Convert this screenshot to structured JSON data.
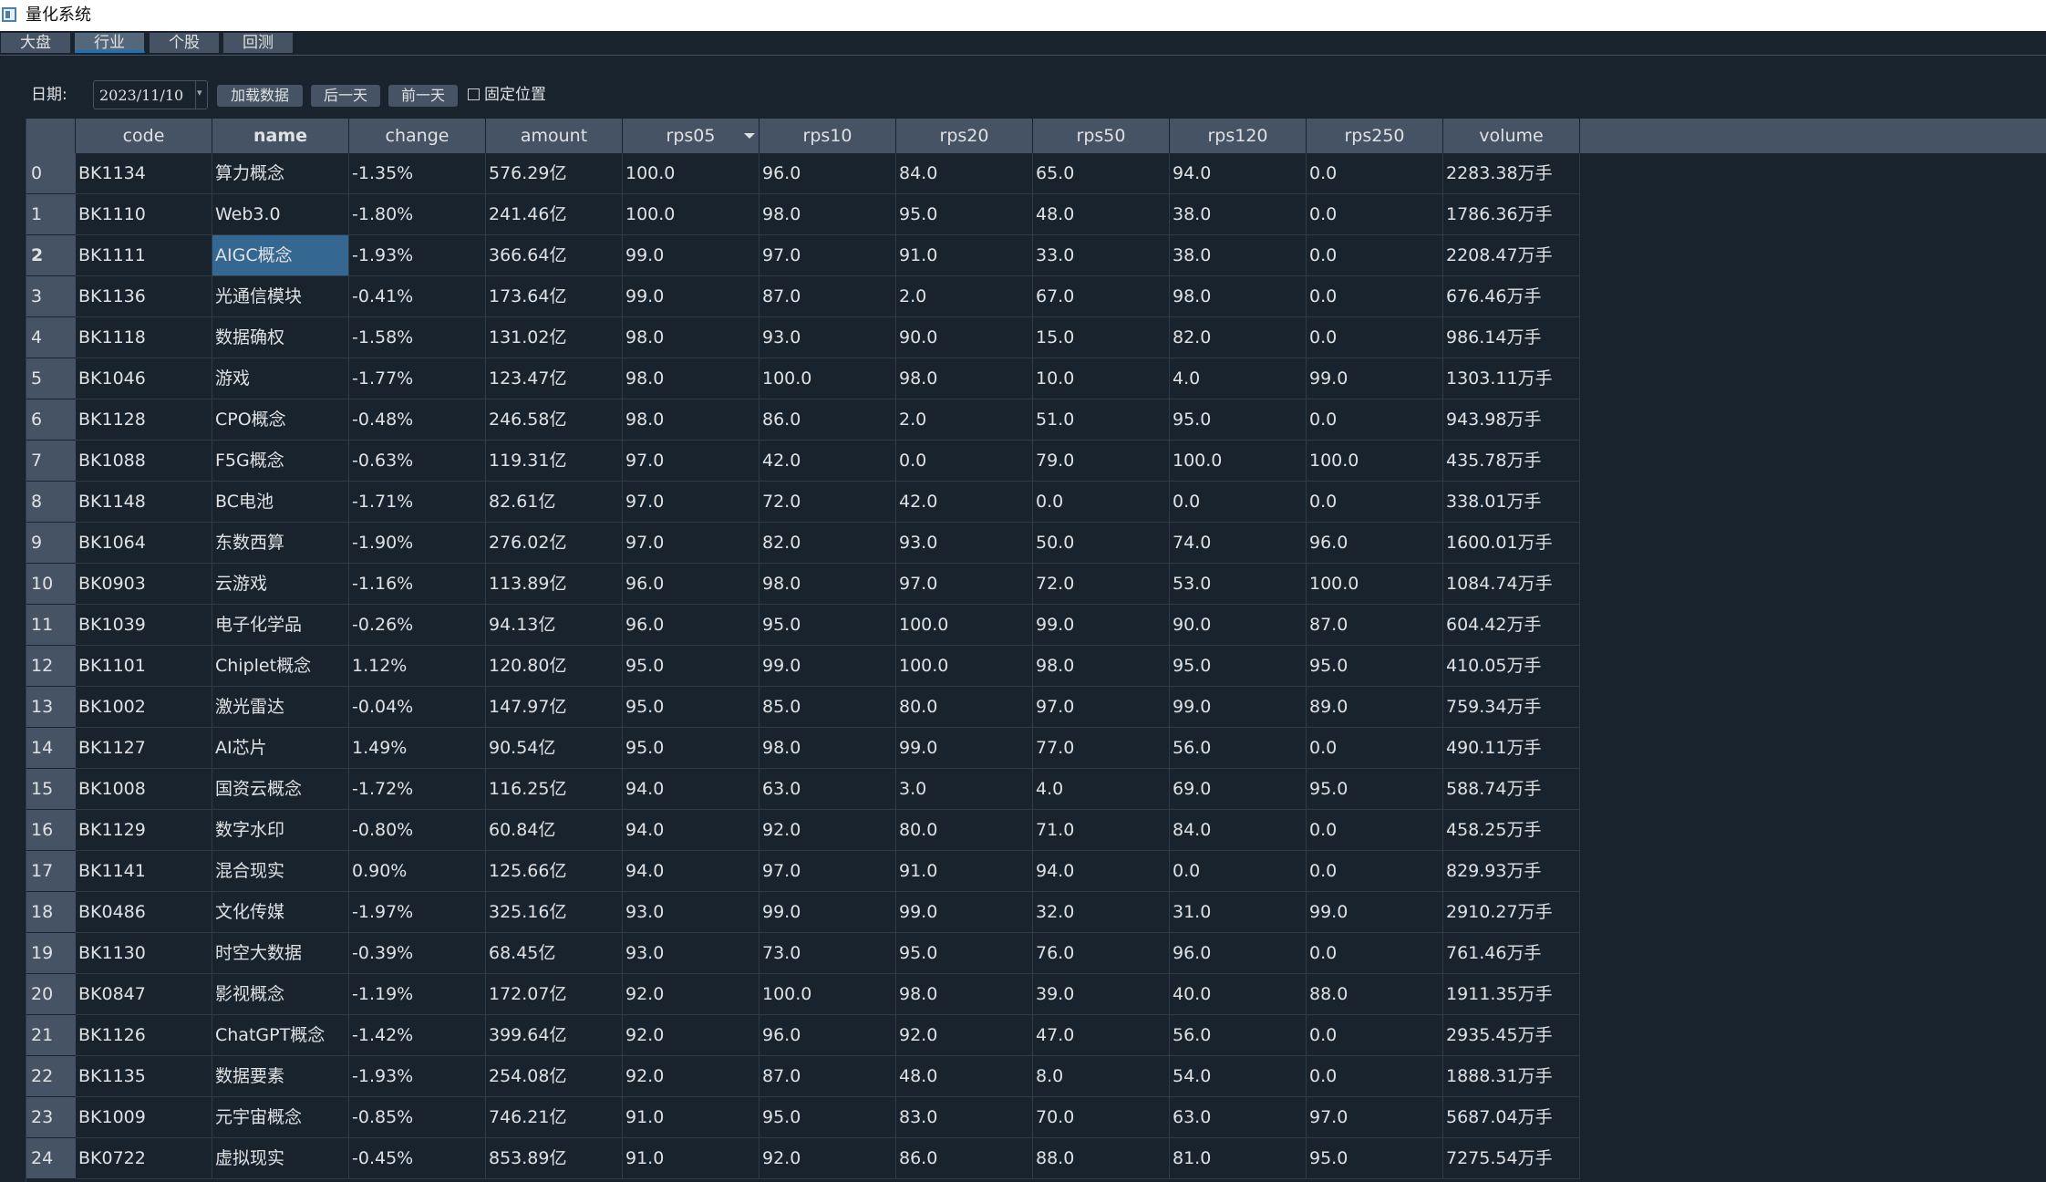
{
  "window": {
    "title": "量化系统",
    "icon": "app-window-icon"
  },
  "tabs": [
    {
      "label": "大盘"
    },
    {
      "label": "行业",
      "active": true
    },
    {
      "label": "个股"
    },
    {
      "label": "回测"
    }
  ],
  "toolbar": {
    "date_label": "日期:",
    "date_value": "2023/11/10",
    "load_button": "加载数据",
    "next_day_button": "后一天",
    "prev_day_button": "前一天",
    "fixed_position_label": "固定位置",
    "fixed_position_checked": false
  },
  "table": {
    "columns": [
      "code",
      "name",
      "change",
      "amount",
      "rps05",
      "rps10",
      "rps20",
      "rps50",
      "rps120",
      "rps250",
      "volume"
    ],
    "sorted_column": "rps05",
    "current_row": 2,
    "selected_cell": {
      "row": 2,
      "column": "name"
    },
    "rows": [
      [
        "0",
        "BK1134",
        "算力概念",
        "-1.35%",
        "576.29亿",
        "100.0",
        "96.0",
        "84.0",
        "65.0",
        "94.0",
        "0.0",
        "2283.38万手"
      ],
      [
        "1",
        "BK1110",
        "Web3.0",
        "-1.80%",
        "241.46亿",
        "100.0",
        "98.0",
        "95.0",
        "48.0",
        "38.0",
        "0.0",
        "1786.36万手"
      ],
      [
        "2",
        "BK1111",
        "AIGC概念",
        "-1.93%",
        "366.64亿",
        "99.0",
        "97.0",
        "91.0",
        "33.0",
        "38.0",
        "0.0",
        "2208.47万手"
      ],
      [
        "3",
        "BK1136",
        "光通信模块",
        "-0.41%",
        "173.64亿",
        "99.0",
        "87.0",
        "2.0",
        "67.0",
        "98.0",
        "0.0",
        "676.46万手"
      ],
      [
        "4",
        "BK1118",
        "数据确权",
        "-1.58%",
        "131.02亿",
        "98.0",
        "93.0",
        "90.0",
        "15.0",
        "82.0",
        "0.0",
        "986.14万手"
      ],
      [
        "5",
        "BK1046",
        "游戏",
        "-1.77%",
        "123.47亿",
        "98.0",
        "100.0",
        "98.0",
        "10.0",
        "4.0",
        "99.0",
        "1303.11万手"
      ],
      [
        "6",
        "BK1128",
        "CPO概念",
        "-0.48%",
        "246.58亿",
        "98.0",
        "86.0",
        "2.0",
        "51.0",
        "95.0",
        "0.0",
        "943.98万手"
      ],
      [
        "7",
        "BK1088",
        "F5G概念",
        "-0.63%",
        "119.31亿",
        "97.0",
        "42.0",
        "0.0",
        "79.0",
        "100.0",
        "100.0",
        "435.78万手"
      ],
      [
        "8",
        "BK1148",
        "BC电池",
        "-1.71%",
        "82.61亿",
        "97.0",
        "72.0",
        "42.0",
        "0.0",
        "0.0",
        "0.0",
        "338.01万手"
      ],
      [
        "9",
        "BK1064",
        "东数西算",
        "-1.90%",
        "276.02亿",
        "97.0",
        "82.0",
        "93.0",
        "50.0",
        "74.0",
        "96.0",
        "1600.01万手"
      ],
      [
        "10",
        "BK0903",
        "云游戏",
        "-1.16%",
        "113.89亿",
        "96.0",
        "98.0",
        "97.0",
        "72.0",
        "53.0",
        "100.0",
        "1084.74万手"
      ],
      [
        "11",
        "BK1039",
        "电子化学品",
        "-0.26%",
        "94.13亿",
        "96.0",
        "95.0",
        "100.0",
        "99.0",
        "90.0",
        "87.0",
        "604.42万手"
      ],
      [
        "12",
        "BK1101",
        "Chiplet概念",
        "1.12%",
        "120.80亿",
        "95.0",
        "99.0",
        "100.0",
        "98.0",
        "95.0",
        "95.0",
        "410.05万手"
      ],
      [
        "13",
        "BK1002",
        "激光雷达",
        "-0.04%",
        "147.97亿",
        "95.0",
        "85.0",
        "80.0",
        "97.0",
        "99.0",
        "89.0",
        "759.34万手"
      ],
      [
        "14",
        "BK1127",
        "AI芯片",
        "1.49%",
        "90.54亿",
        "95.0",
        "98.0",
        "99.0",
        "77.0",
        "56.0",
        "0.0",
        "490.11万手"
      ],
      [
        "15",
        "BK1008",
        "国资云概念",
        "-1.72%",
        "116.25亿",
        "94.0",
        "63.0",
        "3.0",
        "4.0",
        "69.0",
        "95.0",
        "588.74万手"
      ],
      [
        "16",
        "BK1129",
        "数字水印",
        "-0.80%",
        "60.84亿",
        "94.0",
        "92.0",
        "80.0",
        "71.0",
        "84.0",
        "0.0",
        "458.25万手"
      ],
      [
        "17",
        "BK1141",
        "混合现实",
        "0.90%",
        "125.66亿",
        "94.0",
        "97.0",
        "91.0",
        "94.0",
        "0.0",
        "0.0",
        "829.93万手"
      ],
      [
        "18",
        "BK0486",
        "文化传媒",
        "-1.97%",
        "325.16亿",
        "93.0",
        "99.0",
        "99.0",
        "32.0",
        "31.0",
        "99.0",
        "2910.27万手"
      ],
      [
        "19",
        "BK1130",
        "时空大数据",
        "-0.39%",
        "68.45亿",
        "93.0",
        "73.0",
        "95.0",
        "76.0",
        "96.0",
        "0.0",
        "761.46万手"
      ],
      [
        "20",
        "BK0847",
        "影视概念",
        "-1.19%",
        "172.07亿",
        "92.0",
        "100.0",
        "98.0",
        "39.0",
        "40.0",
        "88.0",
        "1911.35万手"
      ],
      [
        "21",
        "BK1126",
        "ChatGPT概念",
        "-1.42%",
        "399.64亿",
        "92.0",
        "96.0",
        "92.0",
        "47.0",
        "56.0",
        "0.0",
        "2935.45万手"
      ],
      [
        "22",
        "BK1135",
        "数据要素",
        "-1.93%",
        "254.08亿",
        "92.0",
        "87.0",
        "48.0",
        "8.0",
        "54.0",
        "0.0",
        "1888.31万手"
      ],
      [
        "23",
        "BK1009",
        "元宇宙概念",
        "-0.85%",
        "746.21亿",
        "91.0",
        "95.0",
        "83.0",
        "70.0",
        "63.0",
        "97.0",
        "5687.04万手"
      ],
      [
        "24",
        "BK0722",
        "虚拟现实",
        "-0.45%",
        "853.89亿",
        "91.0",
        "92.0",
        "86.0",
        "88.0",
        "81.0",
        "95.0",
        "7275.54万手"
      ]
    ]
  },
  "colors": {
    "background": "#19232d",
    "header": "#455364",
    "selection": "#346792",
    "tab_accent": "#1a72bb",
    "grid": "#2e3a46"
  }
}
